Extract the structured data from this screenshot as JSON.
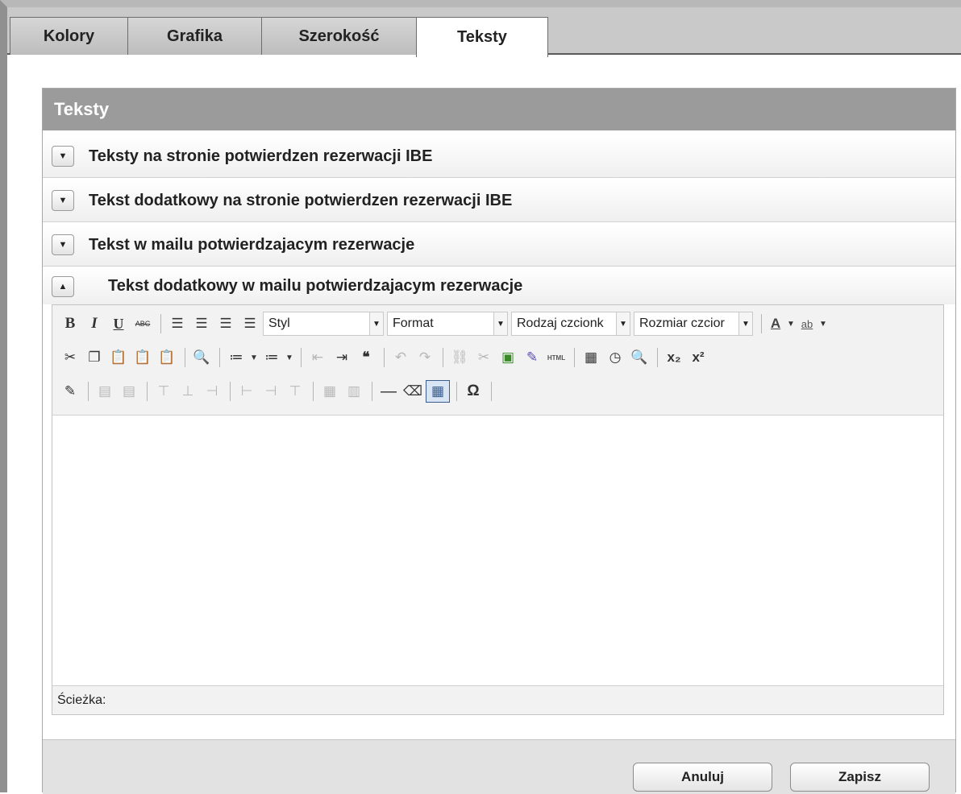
{
  "tabs": [
    {
      "label": "Kolory",
      "active": false
    },
    {
      "label": "Grafika",
      "active": false
    },
    {
      "label": "Szerokość",
      "active": false
    },
    {
      "label": "Teksty",
      "active": true
    }
  ],
  "panel": {
    "title": "Teksty",
    "sections": [
      {
        "label": "Teksty na stronie potwierdzen rezerwacji IBE",
        "toggle": "▼",
        "expanded": false
      },
      {
        "label": "Tekst dodatkowy na stronie potwierdzen rezerwacji IBE",
        "toggle": "▼",
        "expanded": false
      },
      {
        "label": "Tekst w mailu potwierdzajacym rezerwacje",
        "toggle": "▼",
        "expanded": false
      },
      {
        "label": "Tekst dodatkowy w mailu potwierdzajacym rezerwacje",
        "toggle": "▲",
        "expanded": true
      }
    ]
  },
  "editor": {
    "toolbar": {
      "bold": "B",
      "italic": "I",
      "underline": "U",
      "strike": "ABC",
      "style_select": "Styl",
      "format_select": "Format",
      "font_select": "Rodzaj czcionk",
      "size_select": "Rozmiar czcior",
      "font_color": "A",
      "highlight": "ab",
      "html": "HTML",
      "omega": "Ω",
      "subscript": "x₂",
      "superscript": "x²"
    },
    "path_label": "Ścieżka:"
  },
  "buttons": {
    "cancel": "Anuluj",
    "save": "Zapisz"
  }
}
